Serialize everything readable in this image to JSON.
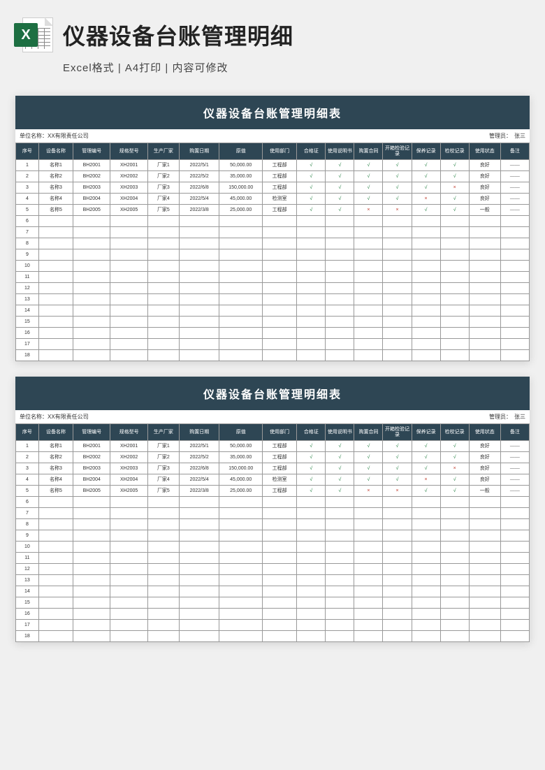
{
  "header": {
    "icon_letter": "X",
    "title": "仪器设备台账管理明细",
    "subtitle": "Excel格式 | A4打印 | 内容可修改"
  },
  "sheet": {
    "title": "仪器设备台账管理明细表",
    "unit_label": "单位名称：",
    "unit_value": "XX有限责任公司",
    "admin_label": "管理员：",
    "admin_value": "张三",
    "columns": [
      "序号",
      "设备名称",
      "管理编号",
      "规格型号",
      "生产厂家",
      "购置日期",
      "原值",
      "使用部门",
      "合格证",
      "使用说明书",
      "购置合同",
      "开箱检验记录",
      "保养记录",
      "检校记录",
      "使用状态",
      "备注"
    ],
    "rows": [
      {
        "seq": "1",
        "name": "名称1",
        "num": "BH2001",
        "model": "XH2001",
        "mfr": "厂家1",
        "date": "2022/5/1",
        "val": "50,000.00",
        "dept": "工程部",
        "cert": "√",
        "man": "√",
        "cont": "√",
        "insp": "√",
        "maint": "√",
        "cal": "√",
        "stat": "良好",
        "note": "——"
      },
      {
        "seq": "2",
        "name": "名称2",
        "num": "BH2002",
        "model": "XH2002",
        "mfr": "厂家2",
        "date": "2022/5/2",
        "val": "35,000.00",
        "dept": "工程部",
        "cert": "√",
        "man": "√",
        "cont": "√",
        "insp": "√",
        "maint": "√",
        "cal": "√",
        "stat": "良好",
        "note": "——"
      },
      {
        "seq": "3",
        "name": "名称3",
        "num": "BH2003",
        "model": "XH2003",
        "mfr": "厂家3",
        "date": "2022/6/8",
        "val": "150,000.00",
        "dept": "工程部",
        "cert": "√",
        "man": "√",
        "cont": "√",
        "insp": "√",
        "maint": "√",
        "cal": "×",
        "stat": "良好",
        "note": "——"
      },
      {
        "seq": "4",
        "name": "名称4",
        "num": "BH2004",
        "model": "XH2004",
        "mfr": "厂家4",
        "date": "2022/5/4",
        "val": "45,000.00",
        "dept": "检测室",
        "cert": "√",
        "man": "√",
        "cont": "√",
        "insp": "√",
        "maint": "×",
        "cal": "√",
        "stat": "良好",
        "note": "——"
      },
      {
        "seq": "5",
        "name": "名称5",
        "num": "BH2005",
        "model": "XH2005",
        "mfr": "厂家5",
        "date": "2022/3/8",
        "val": "25,000.00",
        "dept": "工程部",
        "cert": "√",
        "man": "√",
        "cont": "×",
        "insp": "×",
        "maint": "√",
        "cal": "√",
        "stat": "一般",
        "note": "——"
      }
    ],
    "empty_rows": [
      "6",
      "7",
      "8",
      "9",
      "10",
      "11",
      "12",
      "13",
      "14",
      "15",
      "16",
      "17",
      "18"
    ]
  }
}
